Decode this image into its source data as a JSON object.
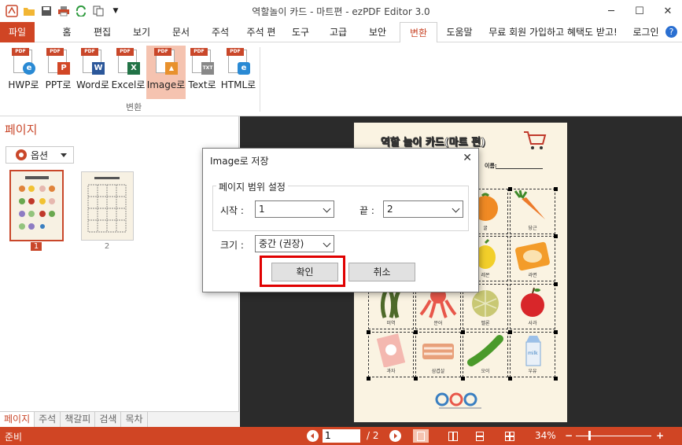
{
  "app": {
    "title": "역할놀이 카드 - 마트편 - ezPDF Editor 3.0"
  },
  "tabs": [
    "파일",
    "홈",
    "편집",
    "보기",
    "문서",
    "주석",
    "주석 편",
    "도구",
    "고급",
    "보안",
    "변환",
    "도움말"
  ],
  "promo": "무료 회원 가입하고 혜택도 받고!",
  "login": "로그인",
  "ribbon": {
    "buttons": [
      {
        "label": "HWP로",
        "badge": "e",
        "color": "#2a8ad4"
      },
      {
        "label": "PPT로",
        "badge": "P",
        "color": "#d24726"
      },
      {
        "label": "Word로",
        "badge": "W",
        "color": "#2b579a"
      },
      {
        "label": "Excel로",
        "badge": "X",
        "color": "#217346"
      },
      {
        "label": "Image로",
        "badge": "▲",
        "color": "#e8912d"
      },
      {
        "label": "Text로",
        "badge": "TXT",
        "color": "#888888"
      },
      {
        "label": "HTML로",
        "badge": "e",
        "color": "#2a8ad4"
      }
    ],
    "group": "변환"
  },
  "left": {
    "title": "페이지",
    "options": "옵션",
    "pages": [
      "1",
      "2"
    ],
    "bottom_tabs": [
      "페이지",
      "주석",
      "책갈피",
      "검색",
      "목차"
    ]
  },
  "status": {
    "ready": "준비",
    "page": "1",
    "total": "/ 2",
    "zoom": "34%"
  },
  "dialog": {
    "title": "Image로 저장",
    "range_legend": "페이지 범위 설정",
    "start_label": "시작 :",
    "start_value": "1",
    "end_label": "끝 :",
    "end_value": "2",
    "size_label": "크기 :",
    "size_value": "중간 (권장)",
    "ok": "확인",
    "cancel": "취소"
  },
  "document": {
    "title": "역할 놀이 카드(마트 편)",
    "name_label": "이름:",
    "items": [
      "귤",
      "당근",
      "레몬",
      "라면",
      "미역",
      "문어",
      "멜론",
      "사과",
      "과자",
      "삼겹살",
      "오이",
      "우유"
    ]
  }
}
